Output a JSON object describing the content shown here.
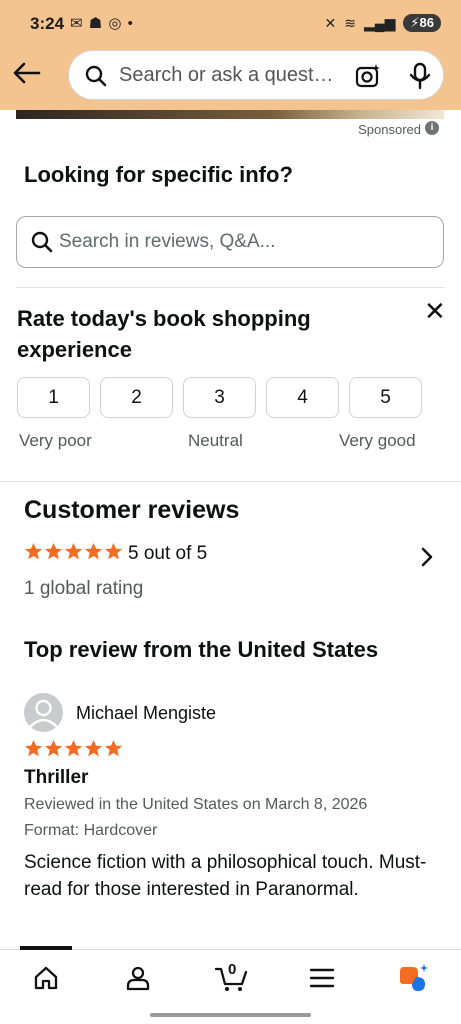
{
  "status_bar": {
    "time": "3:24",
    "battery": "86"
  },
  "search": {
    "placeholder": "Search or ask a quest…"
  },
  "sponsored": {
    "label": "Sponsored"
  },
  "looking": {
    "title": "Looking for specific info?",
    "placeholder": "Search in reviews, Q&A..."
  },
  "rate": {
    "title": "Rate today's book shopping experience",
    "options": [
      "1",
      "2",
      "3",
      "4",
      "5"
    ],
    "labels": {
      "low": "Very poor",
      "mid": "Neutral",
      "high": "Very good"
    }
  },
  "customer_reviews": {
    "title": "Customer reviews",
    "stars": 5,
    "rating_text": "5 out of 5",
    "global_rating": "1 global rating"
  },
  "top_review": {
    "section_title": "Top review from the United States",
    "reviewer": "Michael Mengiste",
    "stars": 5,
    "title": "Thriller",
    "reviewed": "Reviewed in the United States on March 8, 2026",
    "format": "Format: Hardcover",
    "body": "Science fiction with a philosophical touch. Must-read for those interested in Paranormal."
  },
  "colors": {
    "header_bg": "#f3c48f",
    "star": "#f36c21",
    "text": "#0f1111",
    "muted": "#565959"
  },
  "bottom_nav": {
    "icons": [
      "home-icon",
      "account-icon",
      "cart-icon",
      "menu-icon",
      "rufus-icon"
    ],
    "cart_count": "0"
  }
}
